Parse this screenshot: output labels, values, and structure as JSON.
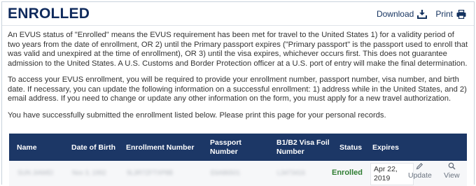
{
  "header": {
    "title": "ENROLLED",
    "download_label": "Download",
    "print_label": "Print"
  },
  "paragraphs": [
    "An EVUS status of \"Enrolled\" means the EVUS requirement has been met for travel to the United States 1) for a validity period of two years from the date of enrollment, OR 2) until the Primary passport expires (\"Primary passport\" is the passport used to enroll that was valid and unexpired at the time of enrollment), OR 3) until the visa expires, whichever occurs first. This does not guarantee admission to the United States. A U.S. Customs and Border Protection officer at a U.S. port of entry will make the final determination.",
    "To access your EVUS enrollment, you will be required to provide your enrollment number, passport number, visa number, and birth date. If necessary, you can update the following information on a successful enrollment: 1) address while in the United States, and 2) email address. If you need to change or update any other information on the form, you must apply for a new travel authorization.",
    "You have successfully submitted the enrollment listed below. Please print this page for your personal records."
  ],
  "table": {
    "columns": [
      "Name",
      "Date of Birth",
      "Enrollment Number",
      "Passport Number",
      "B1/B2 Visa Foil Number",
      "Status",
      "Expires"
    ],
    "row": {
      "name": "SUN JIAWEI",
      "dob": "Nov 3, 1992",
      "enrollment": "9L3R7ZFTXP8B",
      "passport": "E6A86501",
      "visa_foil": "L3473416",
      "status": "Enrolled",
      "expires": "Apr 22, 2019",
      "update_label": "Update",
      "view_label": "View"
    }
  },
  "colors": {
    "title": "#0f2a5c",
    "table_header": "#1c3766",
    "status_enrolled": "#2f7d32"
  }
}
